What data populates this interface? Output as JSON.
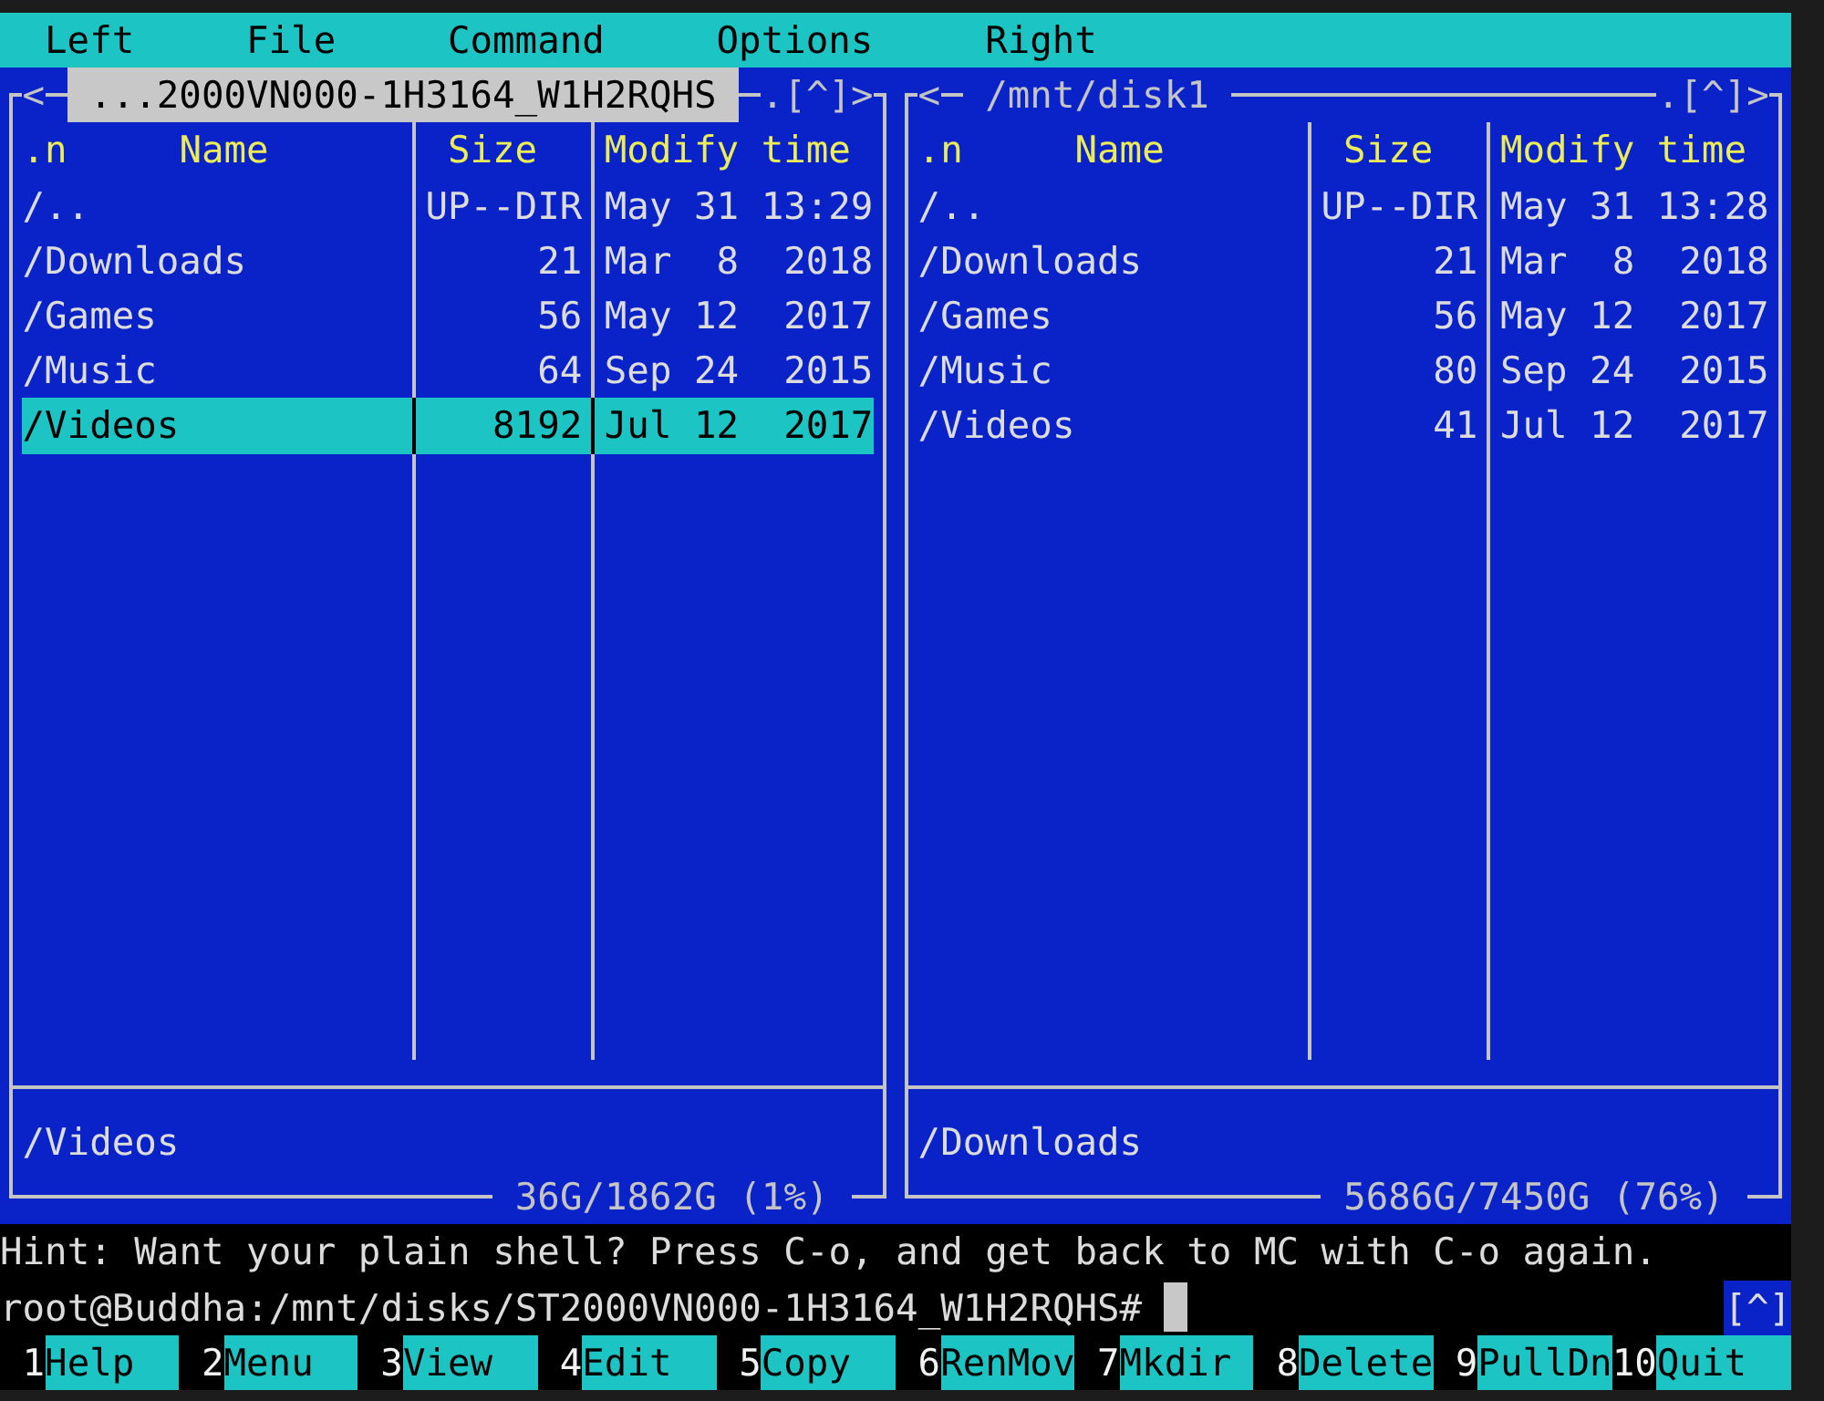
{
  "menu_bar": [
    "Left",
    "File",
    "Command",
    "Options",
    "Right"
  ],
  "panels": [
    {
      "active": true,
      "history_back": "<",
      "path": "...2000VN000-1H3164_W1H2RQHS",
      "hidden_files": ".",
      "hotlist": "[^]",
      "history_forward": ">",
      "columns": {
        "sort": ".n",
        "name": "Name",
        "size": "Size",
        "time": "Modify time"
      },
      "rows": [
        {
          "name": "/..",
          "size": "UP--DIR",
          "time": "May 31 13:29",
          "selected": false
        },
        {
          "name": "/Downloads",
          "size": "21",
          "time": "Mar  8  2018",
          "selected": false
        },
        {
          "name": "/Games",
          "size": "56",
          "time": "May 12  2017",
          "selected": false
        },
        {
          "name": "/Music",
          "size": "64",
          "time": "Sep 24  2015",
          "selected": false
        },
        {
          "name": "/Videos",
          "size": "8192",
          "time": "Jul 12  2017",
          "selected": true
        }
      ],
      "mini_status": "/Videos",
      "free_space": "36G/1862G (1%)"
    },
    {
      "active": false,
      "history_back": "<",
      "path": "/mnt/disk1",
      "hidden_files": ".",
      "hotlist": "[^]",
      "history_forward": ">",
      "columns": {
        "sort": ".n",
        "name": "Name",
        "size": "Size",
        "time": "Modify time"
      },
      "rows": [
        {
          "name": "/..",
          "size": "UP--DIR",
          "time": "May 31 13:28",
          "selected": false
        },
        {
          "name": "/Downloads",
          "size": "21",
          "time": "Mar  8  2018",
          "selected": false
        },
        {
          "name": "/Games",
          "size": "56",
          "time": "May 12  2017",
          "selected": false
        },
        {
          "name": "/Music",
          "size": "80",
          "time": "Sep 24  2015",
          "selected": false
        },
        {
          "name": "/Videos",
          "size": "41",
          "time": "Jul 12  2017",
          "selected": false
        }
      ],
      "mini_status": "/Downloads",
      "free_space": "5686G/7450G (76%)"
    }
  ],
  "hint": "Hint: Want your plain shell? Press C-o, and get back to MC with C-o again.",
  "command_line": {
    "prompt": "root@Buddha:/mnt/disks/ST2000VN000-1H3164_W1H2RQHS#",
    "history_button": "[^]"
  },
  "function_keys": [
    {
      "key": "1",
      "label": "Help"
    },
    {
      "key": "2",
      "label": "Menu"
    },
    {
      "key": "3",
      "label": "View"
    },
    {
      "key": "4",
      "label": "Edit"
    },
    {
      "key": "5",
      "label": "Copy"
    },
    {
      "key": "6",
      "label": "RenMov"
    },
    {
      "key": "7",
      "label": "Mkdir"
    },
    {
      "key": "8",
      "label": "Delete"
    },
    {
      "key": "9",
      "label": "PullDn"
    },
    {
      "key": "10",
      "label": "Quit"
    }
  ]
}
